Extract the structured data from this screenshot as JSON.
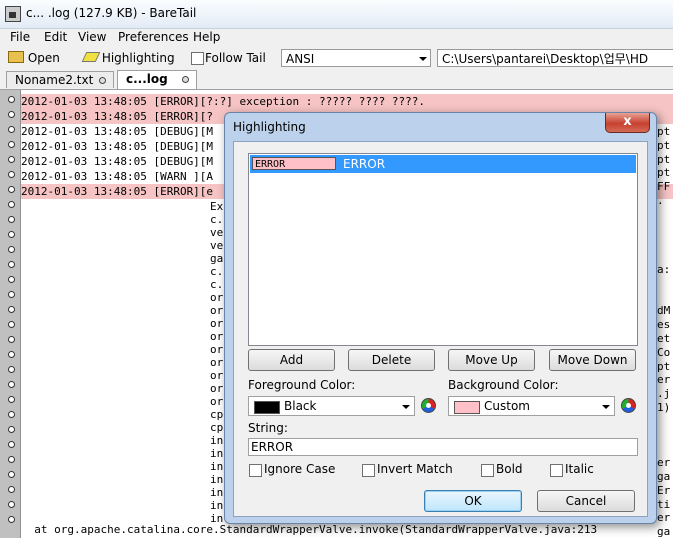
{
  "window": {
    "title": "c... .log (127.9 KB) - BareTail"
  },
  "menu": [
    "File",
    "Edit",
    "View",
    "Preferences",
    "Help"
  ],
  "toolbar": {
    "open_label": "Open",
    "highlighting_label": "Highlighting",
    "follow_tail_label": "Follow Tail",
    "follow_tail_checked": false,
    "encoding_value": "ANSI",
    "path_value": "C:\\Users\\pantarei\\Desktop\\업무\\HD"
  },
  "tabs": [
    {
      "label": "Noname2.txt",
      "active": false
    },
    {
      "label": "c...log",
      "active": true
    }
  ],
  "log": {
    "lines": [
      {
        "text": "2012-01-03 13:48:05 [ERROR][?:?] exception : ????? ???? ????.",
        "level": "error"
      },
      {
        "text": "2012-01-03 13:48:05 [ERROR][?",
        "level": "error"
      },
      {
        "text": "2012-01-03 13:48:05 [DEBUG][M",
        "level": "normal"
      },
      {
        "text": "2012-01-03 13:48:05 [DEBUG][M",
        "level": "normal"
      },
      {
        "text": "2012-01-03 13:48:05 [DEBUG][M",
        "level": "normal"
      },
      {
        "text": "2012-01-03 13:48:05 [WARN ][A",
        "level": "normal"
      },
      {
        "text": "2012-01-03 13:48:05 [ERROR][e",
        "level": "error"
      },
      {
        "text": "",
        "level": "normal"
      }
    ],
    "right_fragments": [
      "pt",
      "pt",
      "pt",
      "pt",
      "FF",
      ".",
      "",
      "",
      "",
      "",
      "a:",
      "",
      "",
      "dM",
      "es",
      "et",
      "Co",
      "pt",
      "er",
      ".j",
      "1)",
      "",
      "",
      "",
      "er",
      "ga",
      "Er",
      "ti",
      "er",
      "ga"
    ],
    "left_fragments": [
      "Ex",
      "c.",
      "ve",
      "ve",
      "ga",
      "c.",
      "c.",
      "or",
      "or",
      "or",
      "or",
      "or",
      "or",
      "or",
      "or",
      "or",
      "cp",
      "cp",
      "in",
      "in",
      "in",
      "in",
      "in",
      "in",
      "in"
    ],
    "bottom_line": "  at org.apache.catalina.core.StandardWrapperValve.invoke(StandardWrapperValve.java:213"
  },
  "dialog": {
    "title": "Highlighting",
    "close_label": "x",
    "entries": [
      {
        "swatch_text": "ERROR",
        "label": "ERROR",
        "background": "#ffc0c8",
        "selected": true
      }
    ],
    "buttons": {
      "add": "Add",
      "delete": "Delete",
      "move_up": "Move Up",
      "move_down": "Move Down",
      "ok": "OK",
      "cancel": "Cancel"
    },
    "foreground": {
      "label": "Foreground Color:",
      "value": "Black",
      "color": "#000000"
    },
    "background": {
      "label": "Background Color:",
      "value": "Custom",
      "color": "#ffc0c8"
    },
    "string": {
      "label": "String:",
      "value": "ERROR"
    },
    "options": [
      {
        "label": "Ignore Case",
        "checked": false
      },
      {
        "label": "Invert Match",
        "checked": false
      },
      {
        "label": "Bold",
        "checked": false
      },
      {
        "label": "Italic",
        "checked": false
      }
    ]
  },
  "colors": {
    "error_row": "#f6c4c4",
    "selection": "#3399ff",
    "dialog_frame": "#bcd1ec"
  }
}
